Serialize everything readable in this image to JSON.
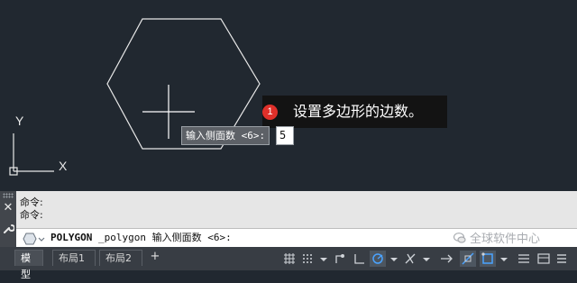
{
  "viewport": {
    "prompt_label": "输入侧面数 <6>:",
    "input_value": "5",
    "callout": {
      "number": "1",
      "text": "设置多边形的边数。"
    },
    "ucs": {
      "x_label": "X",
      "y_label": "Y"
    }
  },
  "command_window": {
    "history": [
      "命令:",
      "命令:"
    ],
    "current_command": "POLYGON",
    "current_args": "_polygon 输入侧面数 <6>:"
  },
  "watermark": "全球软件中心",
  "tabs": [
    "模型",
    "布局1",
    "布局2"
  ],
  "active_tab": "模型",
  "add_tab_label": "+",
  "status_icons": [
    "grid-icon",
    "snap-icon",
    "infer-icon",
    "ortho-icon",
    "polar-icon",
    "osnap-track-icon",
    "object-snap-icon",
    "lineweight-icon",
    "selection-cycling-icon",
    "gizmo-icon",
    "annotation-icon",
    "workspace-icon",
    "customize-icon"
  ],
  "colors": {
    "background": "#212830",
    "accent": "#e0302a",
    "hexagon": "#e8e8e8"
  }
}
